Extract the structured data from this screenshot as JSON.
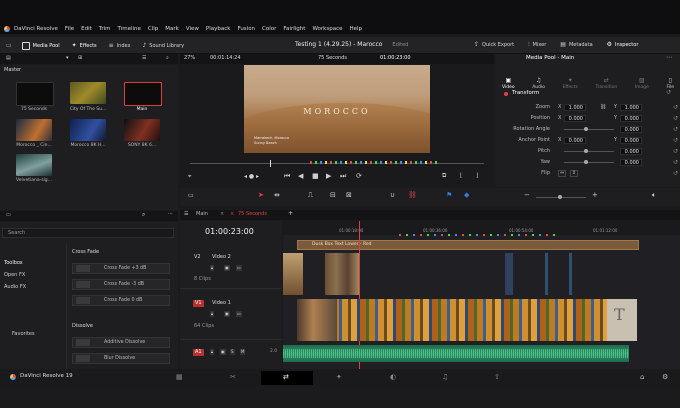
{
  "menu": {
    "app_name": "DaVinci Resolve",
    "items": [
      "File",
      "Edit",
      "Trim",
      "Timeline",
      "Clip",
      "Mark",
      "View",
      "Playback",
      "Fusion",
      "Color",
      "Fairlight",
      "Workspace",
      "Help"
    ]
  },
  "toolbar": {
    "media_pool": "Media Pool",
    "effects": "Effects",
    "index": "Index",
    "sound_library": "Sound Library",
    "project_title": "Testing 1 (4.29.25) - Marocco",
    "project_status": "Edited",
    "quick_export": "Quick Export",
    "mixer": "Mixer",
    "metadata": "Metadata",
    "inspector": "Inspector"
  },
  "media_pool": {
    "bin": "Master",
    "clips": [
      {
        "label": "75 Seconds"
      },
      {
        "label": "City Of The Su..."
      },
      {
        "label": "Main"
      },
      {
        "label": "Morocco _ Cin..."
      },
      {
        "label": "Morocco 8K H..."
      },
      {
        "label": "SONY 8K 6..."
      },
      {
        "label": "Velvetiana-sig..."
      }
    ]
  },
  "viewer": {
    "zoom": "27%",
    "source_tc": "00:01:14:24",
    "timeline_name": "75 Seconds",
    "record_tc": "01:00:23:00",
    "title_text": "MOROCCO",
    "caption_line1": "Marrakech, Morocco",
    "caption_line2": "Sunny Beach"
  },
  "inspector": {
    "header": "Media Pool - Main",
    "tabs": [
      "Video",
      "Audio",
      "Effects",
      "Transition",
      "Image",
      "File"
    ],
    "section": "Transform",
    "zoom_label": "Zoom",
    "zoom_x": "1.000",
    "zoom_y": "1.000",
    "position_label": "Position",
    "position_x": "0.000",
    "position_y": "0.000",
    "rotation_label": "Rotation Angle",
    "rotation": "0.000",
    "anchor_label": "Anchor Point",
    "anchor_x": "0.000",
    "anchor_y": "0.000",
    "pitch_label": "Pitch",
    "pitch": "0.000",
    "yaw_label": "Yaw",
    "yaw": "0.000",
    "flip_label": "Flip"
  },
  "effects_panel": {
    "search_placeholder": "Search",
    "categories": [
      "Toolbox",
      "Open FX",
      "Audio FX"
    ],
    "favorites": "Favorites",
    "group1": "Cross Fade",
    "items1": [
      "Cross Fade +3 dB",
      "Cross Fade -3 dB",
      "Cross Fade 0 dB"
    ],
    "group2": "Dissolve",
    "items2": [
      "Additive Dissolve",
      "Blur Dissolve"
    ]
  },
  "timeline": {
    "tab_main": "Main",
    "tab_75": "75 Seconds",
    "timecode": "01:00:23:00",
    "ruler": [
      "01:00:18:00",
      "01:00:36:00",
      "01:00:54:00",
      "01:01:12:00"
    ],
    "title_clip": "Dusk Box Text Lower - Red",
    "v2_label": "V2",
    "v2_name": "Video 2",
    "v2_clips": "8 Clips",
    "v1_label": "V1",
    "v1_name": "Video 1",
    "v1_clips": "64 Clips",
    "a1_label": "A1",
    "a1_level": "2.0"
  },
  "footer": {
    "brand": "DaVinci Resolve 19"
  }
}
